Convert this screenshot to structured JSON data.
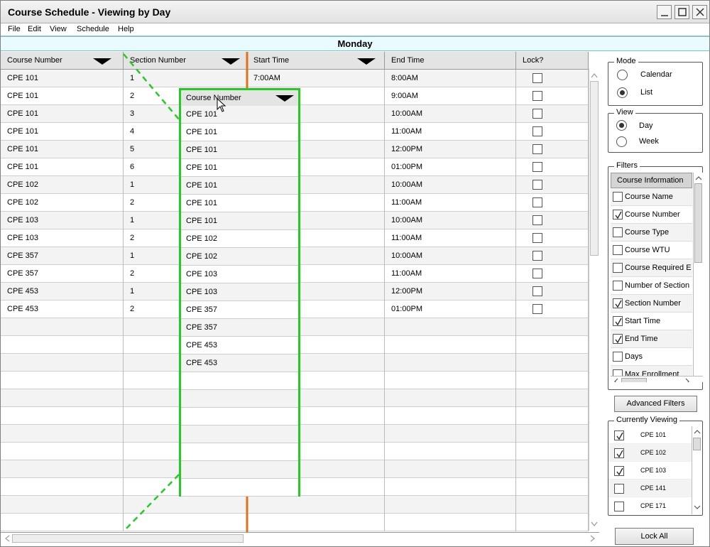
{
  "window": {
    "title": "Course Schedule - Viewing by Day"
  },
  "menu": [
    "File",
    "Edit",
    "View",
    "Schedule",
    "Help"
  ],
  "day": "Monday",
  "table": {
    "headers": [
      "Course Number",
      "Section Number",
      "Start Time",
      "End Time",
      "Lock?"
    ],
    "rows": [
      [
        "CPE 101",
        "1",
        "7:00AM",
        "8:00AM"
      ],
      [
        "CPE 101",
        "2",
        "",
        "9:00AM"
      ],
      [
        "CPE 101",
        "3",
        "",
        "10:00AM"
      ],
      [
        "CPE 101",
        "4",
        "",
        "11:00AM"
      ],
      [
        "CPE 101",
        "5",
        "",
        "12:00PM"
      ],
      [
        "CPE 101",
        "6",
        "",
        "01:00PM"
      ],
      [
        "CPE 102",
        "1",
        "",
        "10:00AM"
      ],
      [
        "CPE 102",
        "2",
        "",
        "11:00AM"
      ],
      [
        "CPE 103",
        "1",
        "",
        "10:00AM"
      ],
      [
        "CPE 103",
        "2",
        "",
        "11:00AM"
      ],
      [
        "CPE 357",
        "1",
        "",
        "10:00AM"
      ],
      [
        "CPE 357",
        "2",
        "",
        "11:00AM"
      ],
      [
        "CPE 453",
        "1",
        "",
        "12:00PM"
      ],
      [
        "CPE 453",
        "2",
        "",
        "01:00PM"
      ],
      [
        "",
        "",
        "",
        ""
      ],
      [
        "",
        "",
        "",
        ""
      ],
      [
        "",
        "",
        "",
        ""
      ],
      [
        "",
        "",
        "",
        ""
      ],
      [
        "",
        "",
        "",
        ""
      ],
      [
        "",
        "",
        "",
        ""
      ],
      [
        "",
        "",
        "",
        ""
      ],
      [
        "",
        "",
        "",
        ""
      ],
      [
        "",
        "",
        "",
        ""
      ],
      [
        "",
        "",
        "",
        ""
      ],
      [
        "",
        "",
        "",
        ""
      ],
      [
        "",
        "",
        "",
        ""
      ]
    ]
  },
  "drag_column": {
    "header": "Course Number",
    "values": [
      "CPE 101",
      "CPE 101",
      "CPE 101",
      "CPE 101",
      "CPE 101",
      "CPE 101",
      "CPE 101",
      "CPE 102",
      "CPE 102",
      "CPE 103",
      "CPE 103",
      "CPE 357",
      "CPE 357",
      "CPE 453",
      "CPE 453"
    ]
  },
  "mode": {
    "label": "Mode",
    "options": [
      "Calendar",
      "List"
    ],
    "selected": "List"
  },
  "view": {
    "label": "View",
    "options": [
      "Day",
      "Week"
    ],
    "selected": "Day"
  },
  "filters": {
    "label": "Filters",
    "header": "Course Information",
    "items": [
      {
        "label": "Course Name",
        "checked": false
      },
      {
        "label": "Course Number",
        "checked": true
      },
      {
        "label": "Course Type",
        "checked": false
      },
      {
        "label": "Course WTU",
        "checked": false
      },
      {
        "label": "Course Required E",
        "checked": false
      },
      {
        "label": "Number of Section",
        "checked": false
      },
      {
        "label": "Section Number",
        "checked": true
      },
      {
        "label": "Start Time",
        "checked": true
      },
      {
        "label": "End Time",
        "checked": true
      },
      {
        "label": "Days",
        "checked": false
      },
      {
        "label": "Max Enrollment",
        "checked": false
      }
    ]
  },
  "advanced_filters": "Advanced Filters",
  "currently_viewing": {
    "label": "Currently Viewing",
    "items": [
      {
        "label": "CPE 101",
        "checked": true
      },
      {
        "label": "CPE 102",
        "checked": true
      },
      {
        "label": "CPE 103",
        "checked": true
      },
      {
        "label": "CPE 141",
        "checked": false
      },
      {
        "label": "CPE 171",
        "checked": false
      }
    ]
  },
  "lock_all": "Lock All",
  "colors": {
    "drag_outline": "#22cc22",
    "insert_marker": "#e0701a",
    "day_band": "#e9fbff"
  }
}
